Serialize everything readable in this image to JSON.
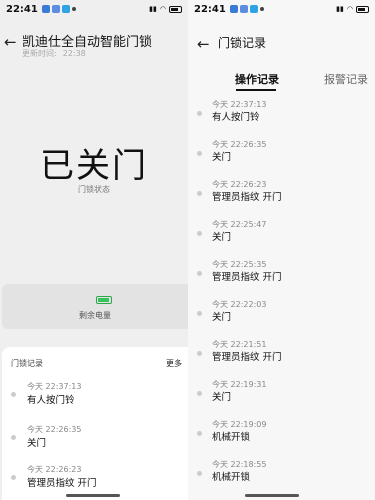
{
  "left": {
    "status": {
      "time": "22:41"
    },
    "title": "凯迪仕全自动智能门锁",
    "updated_label": "更新时间:",
    "updated_time": "22:38",
    "lock_state": "已关门",
    "lock_state_label": "门锁状态",
    "battery": {
      "label": "剩余电量",
      "level": 0.75,
      "color": "#37c35b"
    },
    "records_header": "门锁记录",
    "more_label": "更多",
    "records": [
      {
        "time": "今天 22:37:13",
        "event": "有人按门铃"
      },
      {
        "time": "今天 22:26:35",
        "event": "关门"
      },
      {
        "time": "今天 22:26:23",
        "event": "管理员指纹 开门"
      }
    ]
  },
  "right": {
    "status": {
      "time": "22:41"
    },
    "title": "门锁记录",
    "tabs": [
      {
        "label": "操作记录",
        "active": true
      },
      {
        "label": "报警记录",
        "active": false
      }
    ],
    "records": [
      {
        "time": "今天 22:37:13",
        "event": "有人按门铃"
      },
      {
        "time": "今天 22:26:35",
        "event": "关门"
      },
      {
        "time": "今天 22:26:23",
        "event": "管理员指纹 开门"
      },
      {
        "time": "今天 22:25:47",
        "event": "关门"
      },
      {
        "time": "今天 22:25:35",
        "event": "管理员指纹 开门"
      },
      {
        "time": "今天 22:22:03",
        "event": "关门"
      },
      {
        "time": "今天 22:21:51",
        "event": "管理员指纹 开门"
      },
      {
        "time": "今天 22:19:31",
        "event": "关门"
      },
      {
        "time": "今天 22:19:09",
        "event": "机械开锁"
      },
      {
        "time": "今天 22:18:55",
        "event": "机械开锁"
      }
    ]
  },
  "icons": {
    "back": "arrow-left-icon",
    "battery": "battery-icon",
    "record_dot": "dot-icon"
  }
}
